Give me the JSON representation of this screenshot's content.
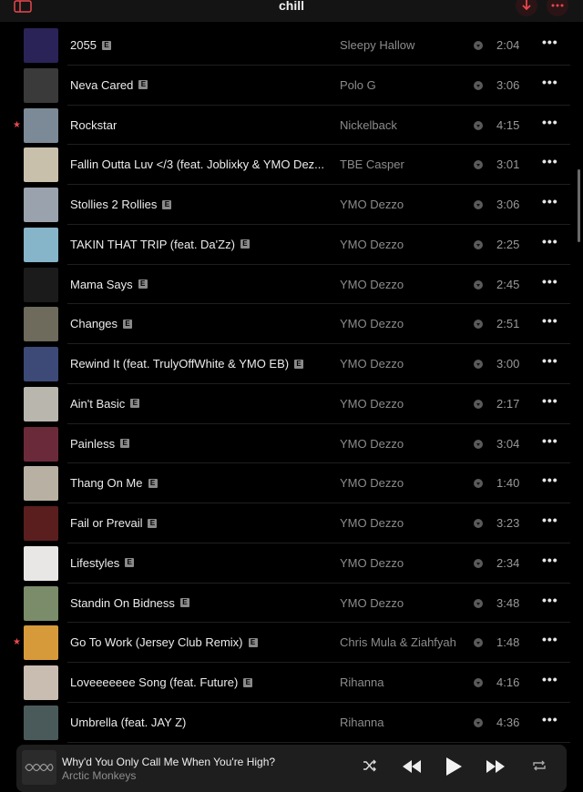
{
  "header": {
    "title": "chill"
  },
  "tracks": [
    {
      "title": "2055",
      "explicit": true,
      "artist": "Sleepy Hallow",
      "duration": "2:04",
      "starred": false,
      "art": "#2a2357"
    },
    {
      "title": "Neva Cared",
      "explicit": true,
      "artist": "Polo G",
      "duration": "3:06",
      "starred": false,
      "art": "#3a3a3a"
    },
    {
      "title": "Rockstar",
      "explicit": false,
      "artist": "Nickelback",
      "duration": "4:15",
      "starred": true,
      "art": "#7b8a96"
    },
    {
      "title": "Fallin Outta Luv </3 (feat. Joblixky & YMO Dez...",
      "explicit": false,
      "artist": "TBE Casper",
      "duration": "3:01",
      "starred": false,
      "art": "#c9c0ac"
    },
    {
      "title": "Stollies 2 Rollies",
      "explicit": true,
      "artist": "YMO Dezzo",
      "duration": "3:06",
      "starred": false,
      "art": "#9aa3ad"
    },
    {
      "title": "TAKIN THAT TRIP (feat. Da'Zz)",
      "explicit": true,
      "artist": "YMO Dezzo",
      "duration": "2:25",
      "starred": false,
      "art": "#86b4c8"
    },
    {
      "title": "Mama Says",
      "explicit": true,
      "artist": "YMO Dezzo",
      "duration": "2:45",
      "starred": false,
      "art": "#1b1b1b"
    },
    {
      "title": "Changes",
      "explicit": true,
      "artist": "YMO Dezzo",
      "duration": "2:51",
      "starred": false,
      "art": "#6e6a5c"
    },
    {
      "title": "Rewind It (feat. TrulyOffWhite & YMO EB)",
      "explicit": true,
      "artist": "YMO Dezzo",
      "duration": "3:00",
      "starred": false,
      "art": "#3d4a78"
    },
    {
      "title": "Ain't Basic",
      "explicit": true,
      "artist": "YMO Dezzo",
      "duration": "2:17",
      "starred": false,
      "art": "#b9b6ae"
    },
    {
      "title": "Painless",
      "explicit": true,
      "artist": "YMO Dezzo",
      "duration": "3:04",
      "starred": false,
      "art": "#6b2a3a"
    },
    {
      "title": "Thang On Me",
      "explicit": true,
      "artist": "YMO Dezzo",
      "duration": "1:40",
      "starred": false,
      "art": "#b8b0a2"
    },
    {
      "title": "Fail or Prevail",
      "explicit": true,
      "artist": "YMO Dezzo",
      "duration": "3:23",
      "starred": false,
      "art": "#5a1e1e"
    },
    {
      "title": "Lifestyles",
      "explicit": true,
      "artist": "YMO Dezzo",
      "duration": "2:34",
      "starred": false,
      "art": "#e9e6e6"
    },
    {
      "title": "Standin On Bidness",
      "explicit": true,
      "artist": "YMO Dezzo",
      "duration": "3:48",
      "starred": false,
      "art": "#7a8c6a"
    },
    {
      "title": "Go To Work (Jersey Club Remix)",
      "explicit": true,
      "artist": "Chris Mula & Ziahfyah",
      "duration": "1:48",
      "starred": true,
      "art": "#d69a3a"
    },
    {
      "title": "Loveeeeeee Song (feat. Future)",
      "explicit": true,
      "artist": "Rihanna",
      "duration": "4:16",
      "starred": false,
      "art": "#c9bcb1"
    },
    {
      "title": "Umbrella (feat. JAY Z)",
      "explicit": false,
      "artist": "Rihanna",
      "duration": "4:36",
      "starred": false,
      "art": "#4a5a5a"
    }
  ],
  "now_playing": {
    "title": "Why'd You Only Call Me When You're High?",
    "artist": "Arctic Monkeys"
  },
  "colors": {
    "accent": "#e8474c",
    "background": "#000000"
  },
  "icons": {
    "sidebar": "sidebar-icon",
    "download": "download-icon",
    "more": "more-icon",
    "shuffle": "shuffle-icon",
    "previous": "previous-icon",
    "play": "play-icon",
    "next": "next-icon",
    "repeat": "repeat-icon"
  }
}
